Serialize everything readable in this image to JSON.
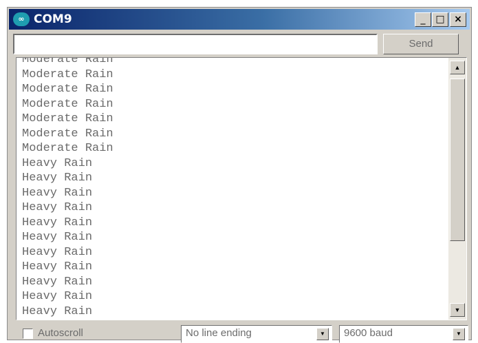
{
  "window": {
    "title": "COM9",
    "app_icon_glyph": "∞",
    "minimize_glyph": "_",
    "maximize_glyph": "□",
    "close_glyph": "×"
  },
  "send_row": {
    "input_value": "",
    "send_label": "Send"
  },
  "output": {
    "lines": [
      "Moderate Rain",
      "Moderate Rain",
      "Moderate Rain",
      "Moderate Rain",
      "Moderate Rain",
      "Moderate Rain",
      "Moderate Rain",
      "Heavy Rain",
      "Heavy Rain",
      "Heavy Rain",
      "Heavy Rain",
      "Heavy Rain",
      "Heavy Rain",
      "Heavy Rain",
      "Heavy Rain",
      "Heavy Rain",
      "Heavy Rain",
      "Heavy Rain"
    ],
    "scroll_up_glyph": "▲",
    "scroll_down_glyph": "▼"
  },
  "bottom_bar": {
    "autoscroll_label": "Autoscroll",
    "autoscroll_checked": false,
    "line_ending_value": "No line ending",
    "baud_value": "9600 baud",
    "dropdown_glyph": "▼"
  },
  "colors": {
    "titlebar_start": "#0a246a",
    "titlebar_end": "#a6caf0",
    "window_face": "#d4d0c8",
    "text_gray": "#6a6a6a"
  }
}
